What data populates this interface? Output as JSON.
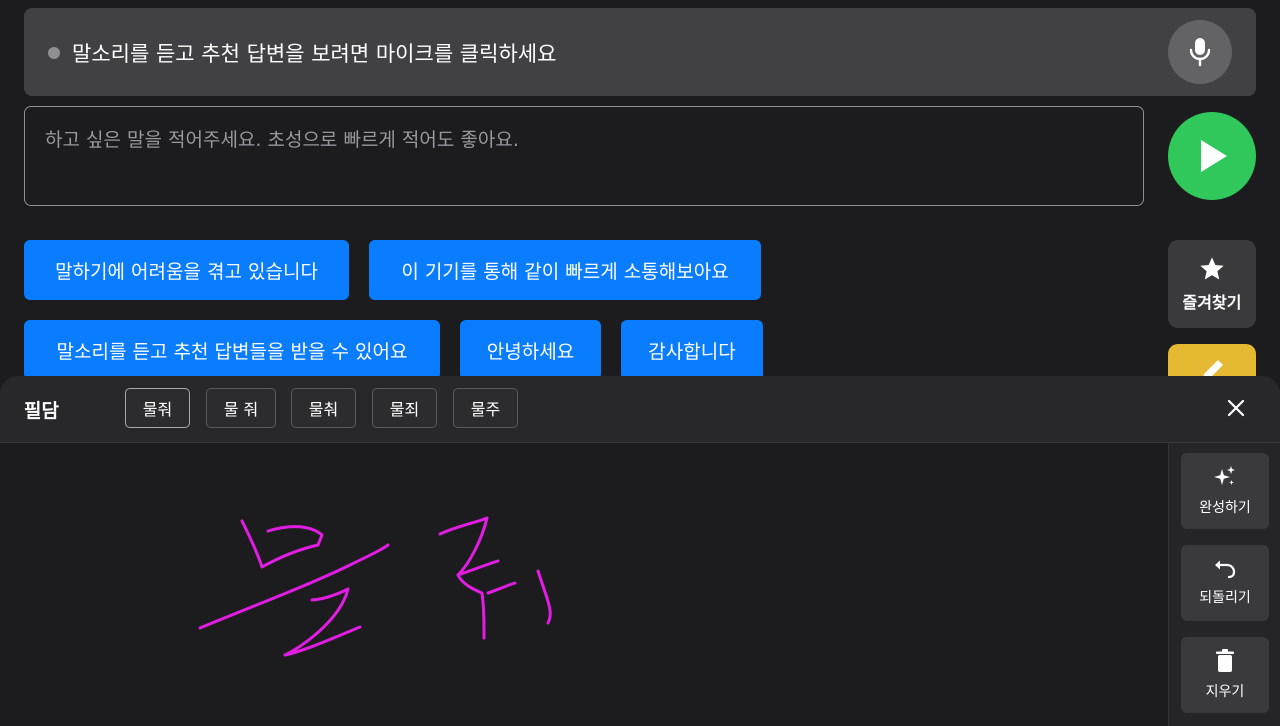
{
  "status": {
    "text": "말소리를 듣고 추천 답변을 보려면 마이크를 클릭하세요"
  },
  "input": {
    "placeholder": "하고 싶은 말을 적어주세요. 초성으로 빠르게 적어도 좋아요.",
    "value": ""
  },
  "phrases": [
    "말하기에 어려움을 겪고 있습니다",
    "이 기기를 통해 같이 빠르게 소통해보아요",
    "말소리를 듣고 추천 답변들을 받을 수 있어요",
    "안녕하세요",
    "감사합니다"
  ],
  "side": {
    "favorites_label": "즐겨찾기"
  },
  "panel": {
    "title": "필담",
    "candidates": [
      "물줘",
      "물 줘",
      "물춰",
      "물죄",
      "물주"
    ],
    "selected_candidate": "물줘",
    "tools": {
      "complete": "완성하기",
      "undo": "되돌리기",
      "clear": "지우기"
    }
  },
  "colors": {
    "accent_blue": "#0a7cff",
    "send_green": "#30c85a",
    "edit_yellow": "#e5b932",
    "ink_magenta": "#e11de3",
    "background": "#1c1c1e"
  },
  "icons": {
    "status": "status-dot",
    "mic": "microphone-icon",
    "send": "play-icon",
    "favorites": "star-icon",
    "edit": "pencil-icon",
    "close": "close-icon",
    "complete": "sparkle-icon",
    "undo": "undo-icon",
    "clear": "trash-icon"
  }
}
